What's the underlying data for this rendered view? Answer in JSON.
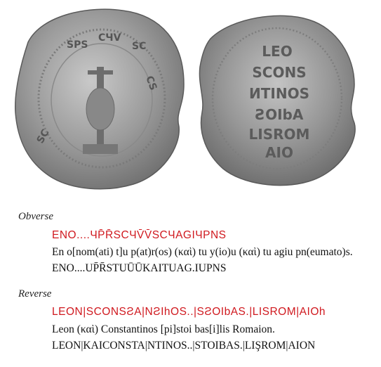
{
  "obverse": {
    "label": "Obverse",
    "inscription_red": "ENO....ЧP̄R̄SCЧV̄V̄SCЧAGIЧPNS",
    "expansion": "En o[nom(ati) t]u p(at)r(os) (καὶ) tu y(io)u (καὶ) tu agiu pn(eumato)s.",
    "transcription": "ENO....UP̄R̄STUŪŪKAITUAG.IUPNS"
  },
  "reverse": {
    "label": "Reverse",
    "inscription_red": "LEON|SCONSƧA|NƧIhOS..|SƧOIbAS.|LISROM|AIOh",
    "expansion": "Leon (καὶ) Constantinos [pi]stoi bas[i]lis Romaion.",
    "transcription": "LEON|KAICONSTA|NTINOS..|STOIBAS.|LIŞROM|AION"
  },
  "images": {
    "obverse_photo": "seal obverse",
    "reverse_photo": "seal reverse"
  }
}
